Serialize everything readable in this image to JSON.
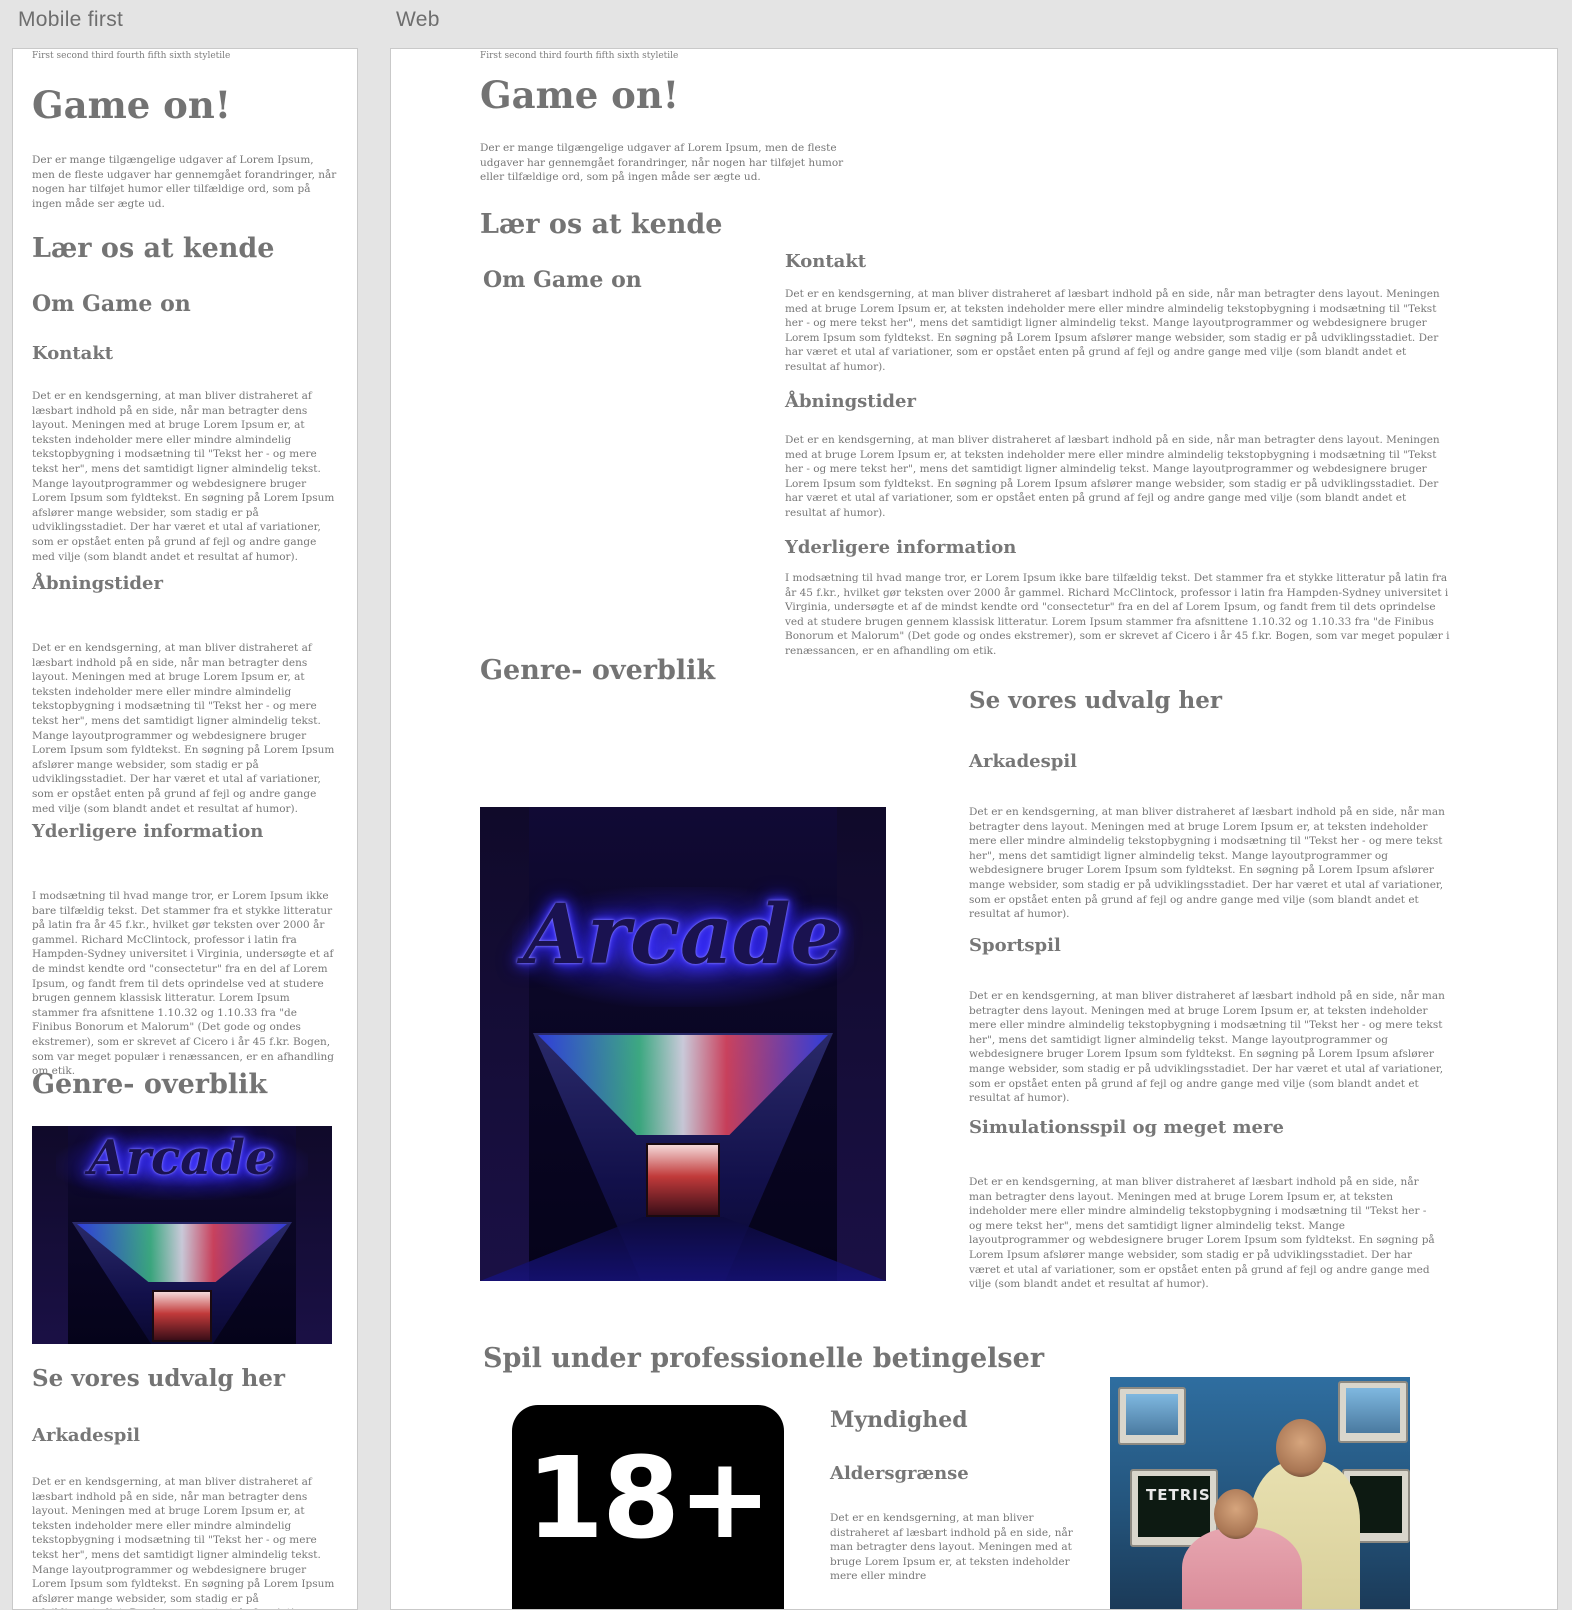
{
  "artboards": {
    "mobile_title": "Mobile first",
    "web_title": "Web"
  },
  "content": {
    "styletile": "First second third fourth fifth sixth styletile",
    "title": "Game on!",
    "intro": "Der er mange tilgængelige udgaver af Lorem Ipsum, men de fleste udgaver har gennemgået forandringer, når nogen har tilføjet humor eller tilfældige ord, som på ingen måde ser ægte ud.",
    "laer_heading": "Lær os at kende",
    "om_heading": "Om Game on",
    "kontakt_heading": "Kontakt",
    "kontakt_text": "Det er en kendsgerning, at man bliver distraheret af læsbart indhold på en side, når man betragter dens layout. Meningen med at bruge Lorem Ipsum er, at teksten indeholder mere eller mindre almindelig tekstopbygning i modsætning til \"Tekst her - og mere tekst her\", mens det samtidigt ligner almindelig tekst. Mange layoutprogrammer og webdesignere bruger Lorem Ipsum som fyldtekst. En søgning på Lorem Ipsum afslører mange websider, som stadig er på udviklingsstadiet. Der har været et utal af variationer, som er opstået enten på grund af fejl og andre gange med vilje (som blandt andet et resultat af humor).",
    "aabning_heading": "Åbningstider",
    "aabning_text": "Det er en kendsgerning, at man bliver distraheret af læsbart indhold på en side, når man betragter dens layout. Meningen med at bruge Lorem Ipsum er, at teksten indeholder mere eller mindre almindelig tekstopbygning i modsætning til \"Tekst her - og mere tekst her\", mens det samtidigt ligner almindelig tekst. Mange layoutprogrammer og webdesignere bruger Lorem Ipsum som fyldtekst. En søgning på Lorem Ipsum afslører mange websider, som stadig er på udviklingsstadiet. Der har været et utal af variationer, som er opstået enten på grund af fejl og andre gange med vilje (som blandt andet et resultat af humor).",
    "yderligere_heading": "Yderligere information",
    "yderligere_text": "I modsætning til hvad mange tror, er Lorem Ipsum ikke bare tilfældig tekst. Det stammer fra et stykke litteratur på latin fra år 45 f.kr., hvilket gør teksten over 2000 år gammel. Richard McClintock, professor i latin fra Hampden-Sydney universitet i Virginia, undersøgte et af de mindst kendte ord \"consectetur\" fra en del af Lorem Ipsum, og fandt frem til dets oprindelse ved at studere brugen gennem klassisk litteratur. Lorem Ipsum stammer fra afsnittene 1.10.32 og 1.10.33 fra \"de Finibus Bonorum et Malorum\" (Det gode og ondes ekstremer), som er skrevet af Cicero i år 45 f.kr. Bogen, som var meget populær i renæssancen, er en afhandling om etik.",
    "genre_heading": "Genre- overblik",
    "arcade_sign": "Arcade",
    "udvalg_heading": "Se vores udvalg her",
    "arkade_heading": "Arkadespil",
    "arkade_text": "Det er en kendsgerning, at man bliver distraheret af læsbart indhold på en side, når man betragter dens layout. Meningen med at bruge Lorem Ipsum er, at teksten indeholder mere eller mindre almindelig tekstopbygning i modsætning til \"Tekst her - og mere tekst her\", mens det samtidigt ligner almindelig tekst. Mange layoutprogrammer og webdesignere bruger Lorem Ipsum som fyldtekst. En søgning på Lorem Ipsum afslører mange websider, som stadig er på udviklingsstadiet. Der har været et utal af variationer, som er opstået enten på grund af fejl og andre gange med vilje (som blandt andet et resultat af humor).",
    "sport_heading": "Sportspil",
    "sport_text": "Det er en kendsgerning, at man bliver distraheret af læsbart indhold på en side, når man betragter dens layout. Meningen med at bruge Lorem Ipsum er, at teksten indeholder mere eller mindre almindelig tekstopbygning i modsætning til \"Tekst her - og mere tekst her\", mens det samtidigt ligner almindelig tekst. Mange layoutprogrammer og webdesignere bruger Lorem Ipsum som fyldtekst. En søgning på Lorem Ipsum afslører mange websider, som stadig er på udviklingsstadiet. Der har været et utal af variationer, som er opstået enten på grund af fejl og andre gange med vilje (som blandt andet et resultat af humor).",
    "sim_heading": "Simulationsspil og meget mere",
    "sim_text": "Det er en kendsgerning, at man bliver distraheret af læsbart indhold på en side, når man betragter dens layout. Meningen med at bruge Lorem Ipsum er, at teksten indeholder mere eller mindre almindelig tekstopbygning i modsætning til \"Tekst her - og mere tekst her\", mens det samtidigt ligner almindelig tekst. Mange layoutprogrammer og webdesignere bruger Lorem Ipsum som fyldtekst. En søgning på Lorem Ipsum afslører mange websider, som stadig er på udviklingsstadiet. Der har været et utal af variationer, som er opstået enten på grund af fejl og andre gange med vilje (som blandt andet et resultat af humor).",
    "pro_heading": "Spil under professionelle betingelser",
    "age_badge": "18+",
    "myndighed_heading": "Myndighed",
    "alder_heading": "Aldersgrænse",
    "alder_text": "Det er en kendsgerning, at man bliver distraheret af læsbart indhold på en side, når man betragter dens layout. Meningen med at bruge Lorem Ipsum er, at teksten indeholder mere eller mindre",
    "tetris_label": "TETRIS"
  }
}
